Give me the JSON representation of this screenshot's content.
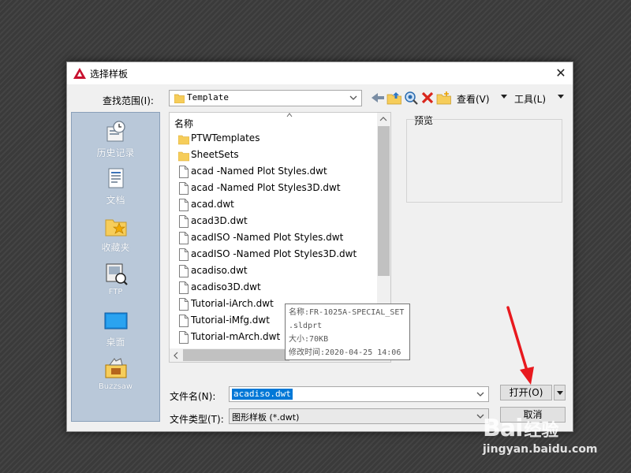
{
  "dialog": {
    "title": "选择样板",
    "close_glyph": "✕"
  },
  "toolbar": {
    "look_in_label": "查找范围(I):",
    "look_in_value": "Template",
    "views_label": "查看(V)",
    "tools_label": "工具(L)"
  },
  "places": [
    {
      "label": "历史记录",
      "icon": "history-icon"
    },
    {
      "label": "文档",
      "icon": "documents-icon"
    },
    {
      "label": "收藏夹",
      "icon": "favorites-icon"
    },
    {
      "label": "FTP",
      "icon": "ftp-icon"
    },
    {
      "label": "桌面",
      "icon": "desktop-icon"
    },
    {
      "label": "Buzzsaw",
      "icon": "buzzsaw-icon"
    }
  ],
  "file_list": {
    "column_header": "名称",
    "items": [
      {
        "name": "PTWTemplates",
        "type": "folder"
      },
      {
        "name": "SheetSets",
        "type": "folder"
      },
      {
        "name": "acad -Named Plot Styles.dwt",
        "type": "file"
      },
      {
        "name": "acad -Named Plot Styles3D.dwt",
        "type": "file"
      },
      {
        "name": "acad.dwt",
        "type": "file"
      },
      {
        "name": "acad3D.dwt",
        "type": "file"
      },
      {
        "name": "acadISO -Named Plot Styles.dwt",
        "type": "file"
      },
      {
        "name": "acadISO -Named Plot Styles3D.dwt",
        "type": "file"
      },
      {
        "name": "acadiso.dwt",
        "type": "file"
      },
      {
        "name": "acadiso3D.dwt",
        "type": "file"
      },
      {
        "name": "Tutorial-iArch.dwt",
        "type": "file"
      },
      {
        "name": "Tutorial-iMfg.dwt",
        "type": "file"
      },
      {
        "name": "Tutorial-mArch.dwt",
        "type": "file"
      }
    ]
  },
  "preview": {
    "label": "预览"
  },
  "tooltip": {
    "line1": "名称:FR-1025A-SPECIAL_SET",
    "line2": ".sldprt",
    "line3": "大小:70KB",
    "line4": "修改时间:2020-04-25 14:06"
  },
  "footer": {
    "file_name_label": "文件名(N):",
    "file_name_value": "acadiso.dwt",
    "file_type_label": "文件类型(T):",
    "file_type_value": "图形样板 (*.dwt)",
    "open_button": "打开(O)",
    "cancel_button": "取消"
  },
  "watermark": {
    "logo": "Bai",
    "logo_cn": "经验",
    "url": "jingyan.baidu.com"
  },
  "colors": {
    "places_bg": "#b9c8d9",
    "selection": "#0078d7",
    "annotation_arrow": "#e8191e",
    "folder": "#f6cd5a"
  }
}
